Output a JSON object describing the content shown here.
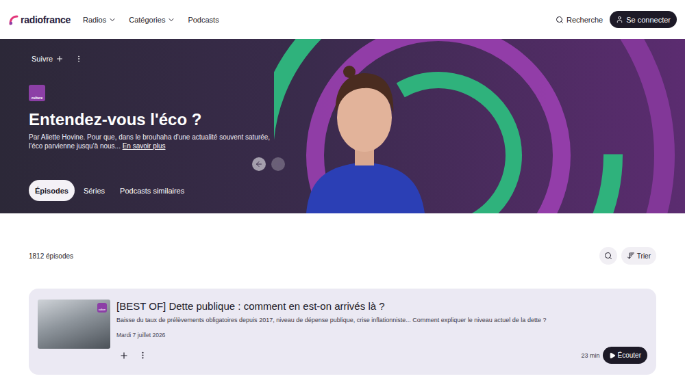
{
  "header": {
    "logo": "radiofrance",
    "nav": [
      {
        "label": "Radios",
        "dropdown": true
      },
      {
        "label": "Catégories",
        "dropdown": true
      },
      {
        "label": "Podcasts",
        "dropdown": false
      }
    ],
    "search": "Recherche",
    "login": "Se connecter"
  },
  "hero": {
    "follow": "Suivre",
    "station_badge": "culture",
    "title": "Entendez-vous l'éco ?",
    "description": "Par Aliette Hovine. Pour que, dans le brouhaha d'une actualité souvent saturée, l'éco parvienne jusqu'à nous...",
    "more_link": "En savoir plus",
    "carousel": {
      "prev_disabled": false,
      "next_disabled": true
    },
    "tabs": [
      {
        "label": "Épisodes",
        "selected": true
      },
      {
        "label": "Séries",
        "selected": false
      },
      {
        "label": "Podcasts similaires",
        "selected": false
      }
    ]
  },
  "episodes": {
    "count": "1812 épisodes",
    "sort": "Trier",
    "items": [
      {
        "title": "[BEST OF] Dette publique : comment en est-on arrivés là ?",
        "description": "Baisse du taux de prélèvements obligatoires depuis 2017, niveau de dépense publique, crise inflationniste... Comment expliquer le niveau actuel de la dette ?",
        "date": "Mardi 7 juillet 2026",
        "duration": "23 min",
        "play": "Écouter",
        "badge": "culture"
      }
    ]
  }
}
